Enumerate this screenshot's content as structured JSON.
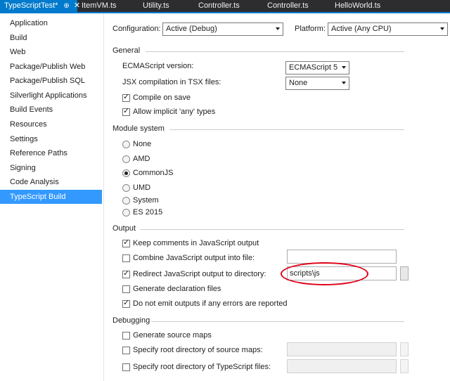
{
  "tabs": [
    {
      "label": "TypeScriptTest*",
      "pin_glyph": "⊕",
      "close_glyph": "✕"
    },
    {
      "label": "ItemVM.ts"
    },
    {
      "label": "Utility.ts"
    },
    {
      "label": "Controller.ts"
    },
    {
      "label": "Controller.ts"
    },
    {
      "label": "HelloWorld.ts"
    }
  ],
  "sidebar": {
    "items": [
      {
        "label": "Application"
      },
      {
        "label": "Build"
      },
      {
        "label": "Web"
      },
      {
        "label": "Package/Publish Web"
      },
      {
        "label": "Package/Publish SQL"
      },
      {
        "label": "Silverlight Applications"
      },
      {
        "label": "Build Events"
      },
      {
        "label": "Resources"
      },
      {
        "label": "Settings"
      },
      {
        "label": "Reference Paths"
      },
      {
        "label": "Signing"
      },
      {
        "label": "Code Analysis"
      },
      {
        "label": "TypeScript Build",
        "selected": true
      }
    ]
  },
  "config": {
    "configuration_label": "Configuration:",
    "configuration_value": "Active (Debug)",
    "platform_label": "Platform:",
    "platform_value": "Active (Any CPU)"
  },
  "general": {
    "title": "General",
    "ecmascript_label": "ECMAScript version:",
    "ecmascript_value": "ECMAScript 5",
    "jsx_label": "JSX compilation in TSX files:",
    "jsx_value": "None",
    "compile_on_save": {
      "label": "Compile on save",
      "checked": true
    },
    "allow_implicit_any": {
      "label": "Allow implicit 'any' types",
      "checked": true
    }
  },
  "module_system": {
    "title": "Module system",
    "options": [
      {
        "label": "None",
        "selected": false
      },
      {
        "label": "AMD",
        "selected": false
      },
      {
        "label": "CommonJS",
        "selected": true
      },
      {
        "label": "UMD",
        "selected": false
      },
      {
        "label": "System",
        "selected": false
      },
      {
        "label": "ES 2015",
        "selected": false
      }
    ]
  },
  "output": {
    "title": "Output",
    "keep_comments": {
      "label": "Keep comments in JavaScript output",
      "checked": true
    },
    "combine_output": {
      "label": "Combine JavaScript output into file:",
      "checked": false,
      "value": ""
    },
    "redirect_output": {
      "label": "Redirect JavaScript output to directory:",
      "checked": true,
      "value": "scripts\\js"
    },
    "generate_declarations": {
      "label": "Generate declaration files",
      "checked": false
    },
    "no_emit_on_error": {
      "label": "Do not emit outputs if any errors are reported",
      "checked": true
    }
  },
  "debugging": {
    "title": "Debugging",
    "generate_source_maps": {
      "label": "Generate source maps",
      "checked": false
    },
    "source_map_root": {
      "label": "Specify root directory of source maps:",
      "checked": false,
      "value": ""
    },
    "typescript_root": {
      "label": "Specify root directory of TypeScript files:",
      "checked": false,
      "value": ""
    }
  },
  "glyphs": {
    "check_mark": "✓"
  },
  "colors": {
    "accent": "#007acc",
    "selection": "#3399ff",
    "annotation": "#e00018"
  }
}
